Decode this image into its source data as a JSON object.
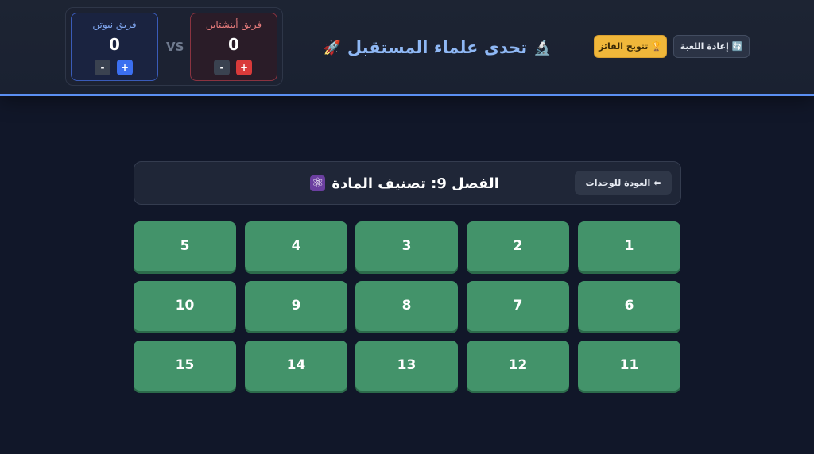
{
  "header": {
    "title": "تحدى علماء المستقبل",
    "title_icon_left": "🚀",
    "title_icon_right": "🔬",
    "winner_button": "🏆 تتويج الفائز",
    "reset_button": "🔄 إعادة اللعبة",
    "vs": "VS"
  },
  "teams": [
    {
      "name": "فريق نيوتن",
      "score": "0",
      "minus": "-",
      "plus": "+",
      "color": "#3b6ff0"
    },
    {
      "name": "فريق أينشتاين",
      "score": "0",
      "minus": "-",
      "plus": "+",
      "color": "#d93a3a"
    }
  ],
  "chapter": {
    "title": "الفصل 9: تصنيف المادة",
    "icon": "⚛",
    "back_button": "⬅ العودة للوحدات"
  },
  "questions": [
    "1",
    "2",
    "3",
    "4",
    "5",
    "6",
    "7",
    "8",
    "9",
    "10",
    "11",
    "12",
    "13",
    "14",
    "15"
  ],
  "colors": {
    "accent": "#5b8ff2",
    "tile": "#43936a",
    "winner": "#f0b73a",
    "background": "#111729"
  }
}
